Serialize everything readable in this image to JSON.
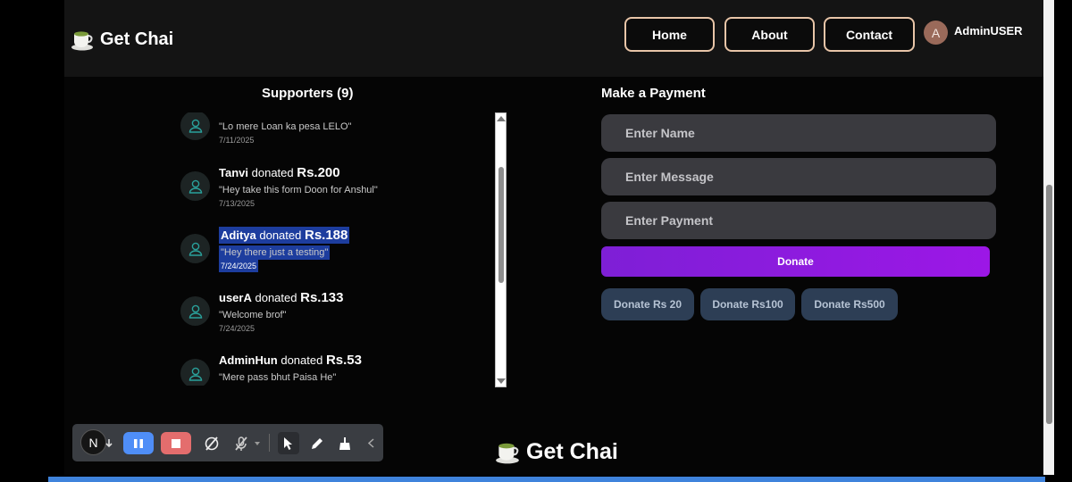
{
  "navbar": {
    "brand": "Get Chai",
    "links": [
      "Home",
      "About",
      "Contact"
    ],
    "user": {
      "initial": "A",
      "name": "AdminUSER"
    }
  },
  "supporters": {
    "title": "Supporters (9)",
    "items": [
      {
        "name": "",
        "verb": "",
        "amount": "",
        "message": "\"Lo mere Loan ka pesa LELO\"",
        "date": "7/11/2025"
      },
      {
        "name": "Tanvi",
        "verb": "donated",
        "amount": "Rs.200",
        "message": "\"Hey take this form Doon for Anshul\"",
        "date": "7/13/2025"
      },
      {
        "name": "Aditya",
        "verb": "donated",
        "amount": "Rs.188",
        "message": "\"Hey there just a testing\"",
        "date": "7/24/2025"
      },
      {
        "name": "userA",
        "verb": "donated",
        "amount": "Rs.133",
        "message": "\"Welcome brof\"",
        "date": "7/24/2025"
      },
      {
        "name": "AdminHun",
        "verb": "donated",
        "amount": "Rs.53",
        "message": "\"Mere pass bhut Paisa He\"",
        "date": ""
      }
    ]
  },
  "payment": {
    "title": "Make a Payment",
    "name_placeholder": "Enter Name",
    "message_placeholder": "Enter Message",
    "amount_placeholder": "Enter Payment",
    "donate_label": "Donate",
    "quick": [
      "Donate Rs 20",
      "Donate Rs100",
      "Donate Rs500"
    ]
  },
  "footer": {
    "brand": "Get Chai"
  },
  "recorder": {
    "badge": "N"
  }
}
